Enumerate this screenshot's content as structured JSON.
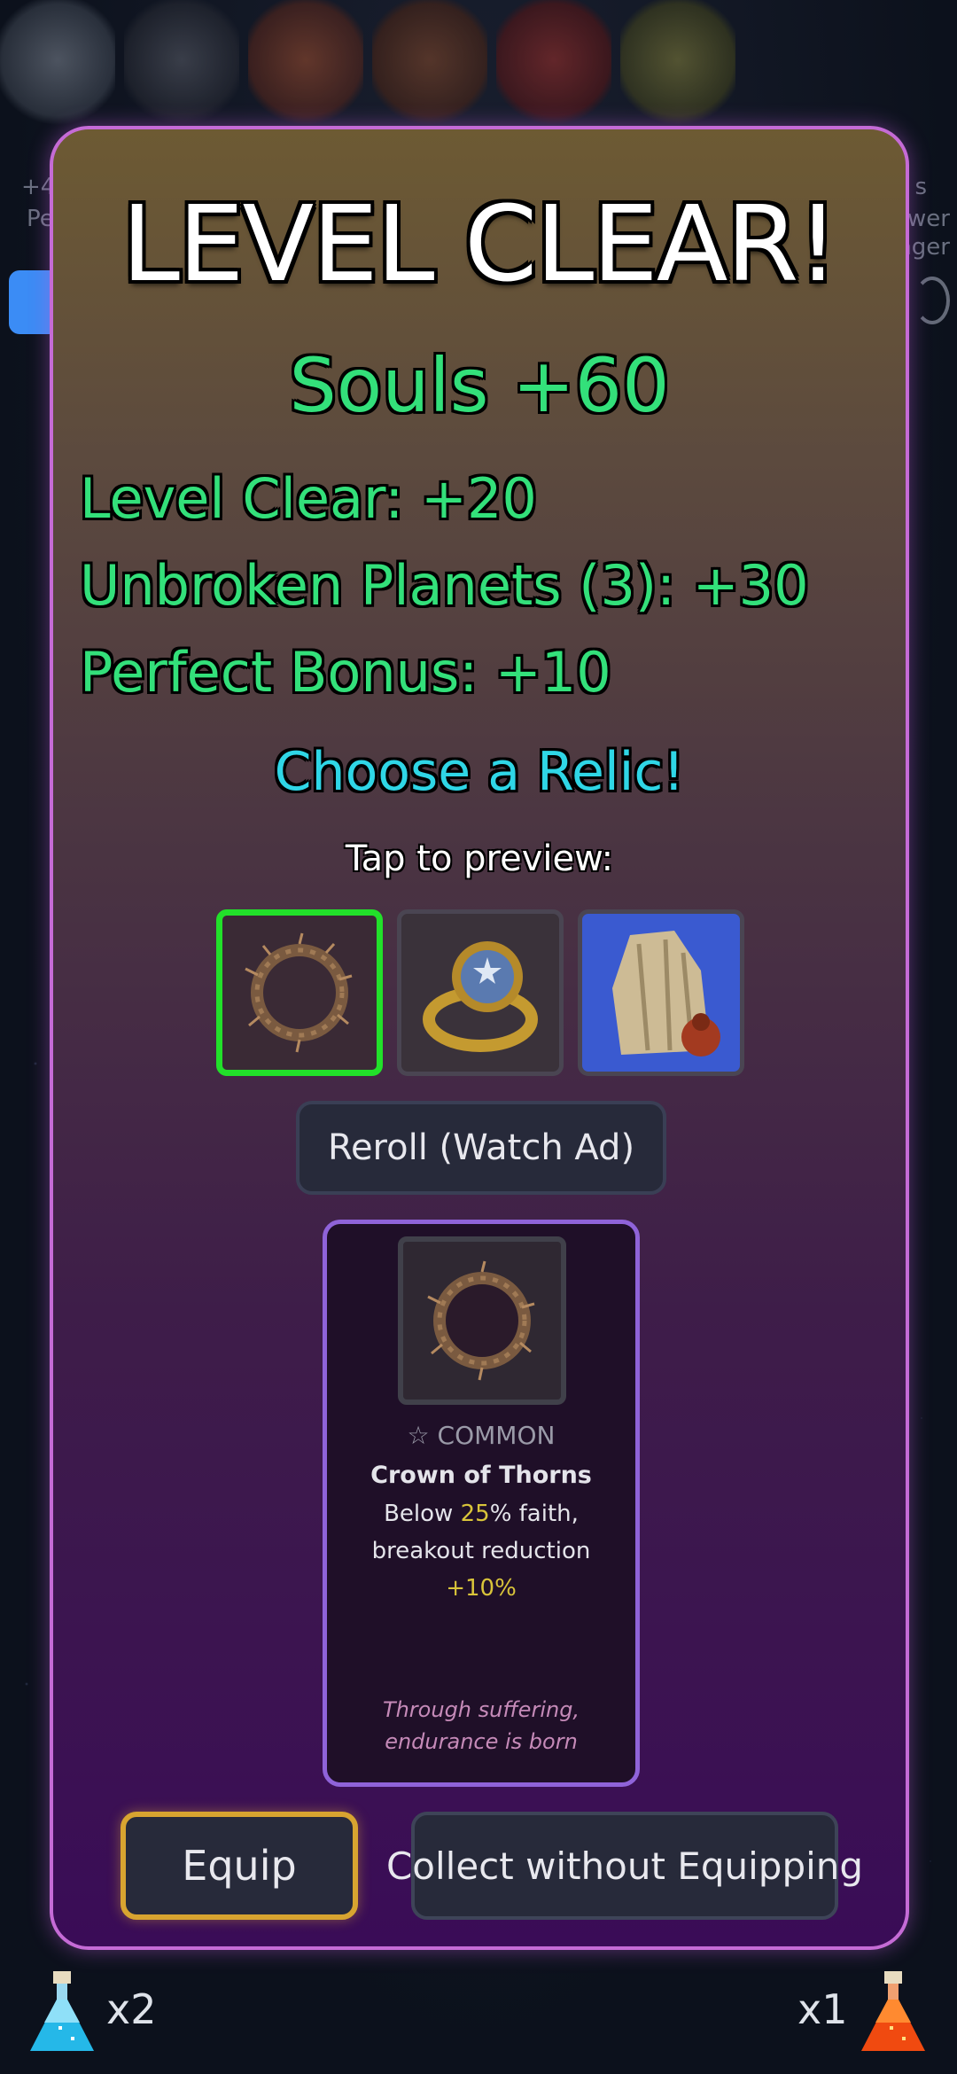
{
  "modal": {
    "title": "LEVEL CLEAR!",
    "souls": "Souls +60",
    "rewards": [
      "Level Clear: +20",
      "Unbroken Planets (3): +30",
      "Perfect Bonus: +10"
    ],
    "choose_label": "Choose a Relic!",
    "tap_label": "Tap to preview:",
    "relics": [
      {
        "name": "crown-of-thorns-icon",
        "selected": true
      },
      {
        "name": "star-ring-icon",
        "selected": false
      },
      {
        "name": "cloak-icon",
        "selected": false
      }
    ],
    "reroll_label": "Reroll (Watch Ad)",
    "detail": {
      "rarity": "☆ COMMON",
      "name": "Crown of Thorns",
      "desc_part1": "Below ",
      "desc_val1": "25",
      "desc_part2": "% faith, breakout reduction ",
      "desc_val2": "+10%",
      "flavor": "Through suffering, endurance is born"
    },
    "equip_label": "Equip",
    "collect_label": "Collect without Equipping"
  },
  "background": {
    "side_left_1": "+4",
    "side_left_2": "Pe",
    "side_right_1": "s",
    "side_right_2": "wer",
    "side_right_3": "nger"
  },
  "potions": {
    "blue_count": "x2",
    "red_count": "x1"
  },
  "colors": {
    "modal_border": "#c56bd6",
    "souls_green": "#33e07a",
    "choose_cyan": "#2fd6e6",
    "selected_green": "#22e02a",
    "equip_gold": "#d8a430"
  }
}
